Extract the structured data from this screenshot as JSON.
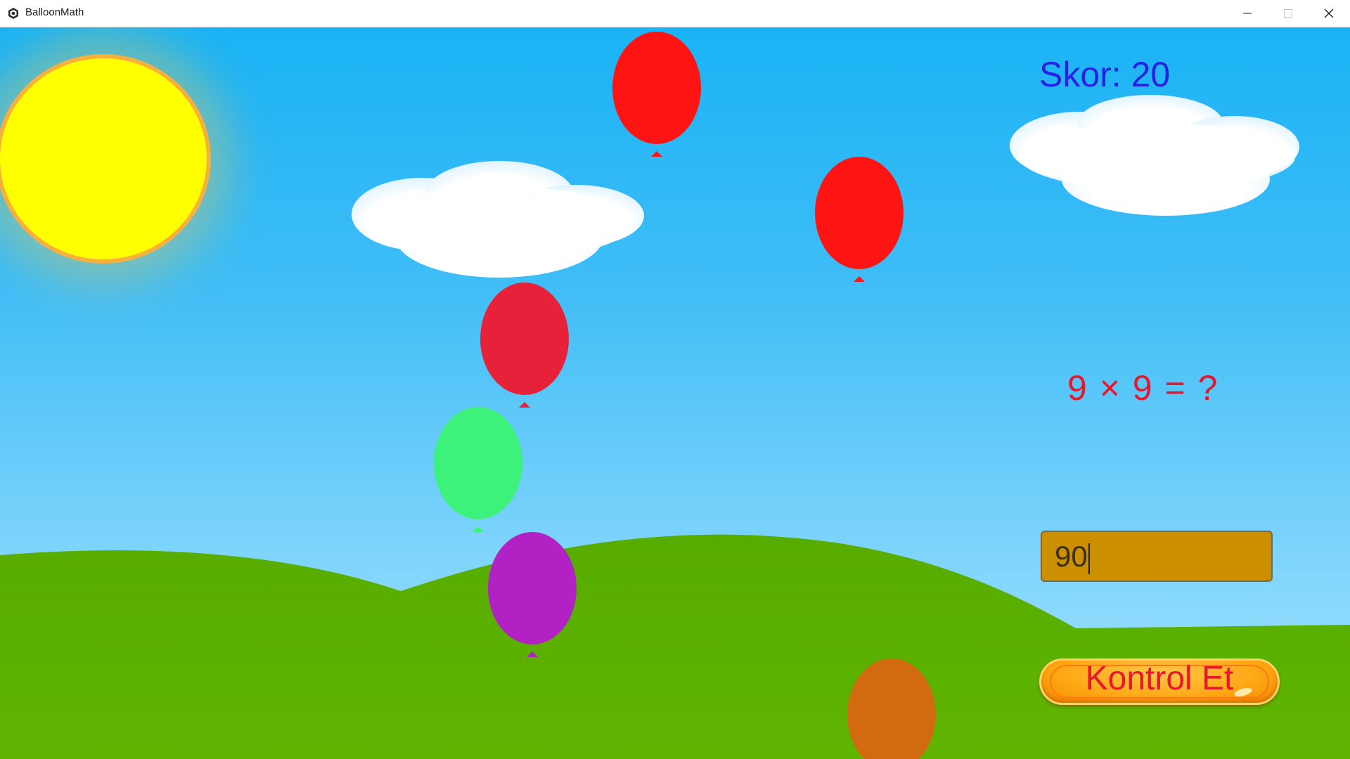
{
  "window": {
    "title": "BalloonMath",
    "controls": [
      "minimize-icon",
      "maximize-icon",
      "close-icon"
    ]
  },
  "game": {
    "score_text": "Skor: 20",
    "question_text": "9 × 9 = ?",
    "answer_value": "90",
    "check_button_label": "Kontrol Et"
  },
  "balloons": [
    {
      "color": "#ff1414"
    },
    {
      "color": "#ff1414"
    },
    {
      "color": "#e8213a"
    },
    {
      "color": "#3cf27a"
    },
    {
      "color": "#b221c4"
    },
    {
      "color": "#d26a10"
    }
  ],
  "colors": {
    "sky_top": "#1ab3f5",
    "sky_bottom": "#a9e4fd",
    "grass": "#5db300",
    "sun": "#ffff00",
    "sun_border": "#f7b03c",
    "score": "#2a1fe6",
    "question": "#e8162d",
    "answer_bg": "#cc8f00",
    "button": "#ffa713"
  }
}
